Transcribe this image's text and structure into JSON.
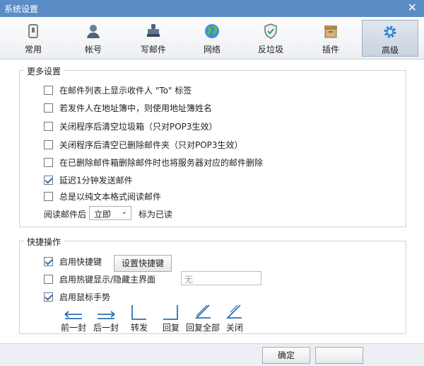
{
  "window": {
    "title": "系统设置",
    "close": "✕"
  },
  "tabs": [
    {
      "label": "常用",
      "icon": "phone-icon"
    },
    {
      "label": "帐号",
      "icon": "user-icon"
    },
    {
      "label": "写邮件",
      "icon": "stamp-icon"
    },
    {
      "label": "网络",
      "icon": "globe-icon"
    },
    {
      "label": "反垃圾",
      "icon": "shield-icon"
    },
    {
      "label": "插件",
      "icon": "box-icon"
    },
    {
      "label": "高级",
      "icon": "gear-icon",
      "active": true
    }
  ],
  "more_settings": {
    "legend": "更多设置",
    "options": [
      {
        "label": "在邮件列表上显示收件人 \"To\" 标签",
        "checked": false
      },
      {
        "label": "若发件人在地址簿中，则使用地址簿姓名",
        "checked": false
      },
      {
        "label": "关闭程序后清空垃圾箱（只对POP3生效）",
        "checked": false
      },
      {
        "label": "关闭程序后清空已删除邮件夹（只对POP3生效）",
        "checked": false
      },
      {
        "label": "在已删除邮件箱删除邮件时也将服务器对应的邮件删除",
        "checked": false
      },
      {
        "label": "延迟1分钟发送邮件",
        "checked": true
      },
      {
        "label": "总是以纯文本格式阅读邮件",
        "checked": false
      }
    ],
    "read_after_prefix": "阅读邮件后",
    "read_after_value": "立即",
    "read_after_suffix": "标为已读"
  },
  "shortcuts": {
    "legend": "快捷操作",
    "enable_hotkeys": {
      "label": "启用快捷键",
      "checked": true
    },
    "set_hotkeys_button": "设置快捷键",
    "hotkey_toggle": {
      "label": "启用热键显示/隐藏主界面",
      "checked": false
    },
    "hotkey_placeholder": "无",
    "mouse_gestures": {
      "label": "启用鼠标手势",
      "checked": true
    },
    "gestures": [
      "前一封",
      "后一封",
      "转发",
      "回复",
      "回复全部",
      "关闭"
    ]
  },
  "footer": {
    "ok": "确定"
  },
  "colors": {
    "titlebar": "#5a8cc6",
    "accent": "#2f6fb5"
  }
}
